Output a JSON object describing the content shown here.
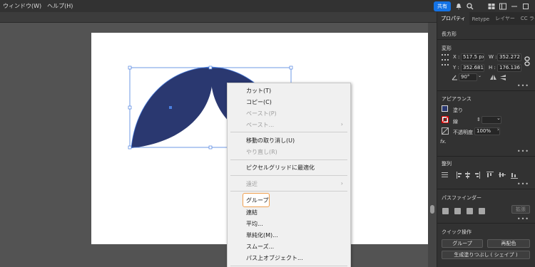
{
  "menubar": {
    "items": [
      "ウィンドウ(W)",
      "ヘルプ(H)"
    ],
    "share_label": "共有"
  },
  "context_menu": {
    "items": [
      {
        "label": "カット(T)",
        "disabled": false
      },
      {
        "label": "コピー(C)",
        "disabled": false
      },
      {
        "label": "ペースト(P)",
        "disabled": true
      },
      {
        "label": "ペースト...",
        "disabled": true,
        "submenu": true
      },
      {
        "label": "移動の取り消し(U)",
        "disabled": false
      },
      {
        "label": "やり直し(R)",
        "disabled": true
      },
      {
        "label": "ピクセルグリッドに最適化",
        "disabled": false
      },
      {
        "label": "遠近",
        "disabled": true,
        "submenu": true
      },
      {
        "label": "グループ",
        "disabled": false,
        "highlighted": true
      },
      {
        "label": "連結",
        "disabled": false
      },
      {
        "label": "平均...",
        "disabled": false
      },
      {
        "label": "単純化(M)...",
        "disabled": false
      },
      {
        "label": "スムーズ...",
        "disabled": false
      },
      {
        "label": "パス上オブジェクト...",
        "disabled": false
      }
    ]
  },
  "panel": {
    "tabs": [
      "プロパティ",
      "Retype",
      "レイヤー",
      "CC ライブ"
    ],
    "object_type": "長方形",
    "transform": {
      "title": "変形",
      "x_label": "X :",
      "x_value": "517.5 px",
      "y_label": "Y :",
      "y_value": "352.681",
      "w_label": "W :",
      "w_value": "352.272",
      "h_label": "H :",
      "h_value": "176.136",
      "angle_value": "90°"
    },
    "appearance": {
      "title": "アピアランス",
      "fill_label": "塗り",
      "stroke_label": "線",
      "opacity_label": "不透明度",
      "opacity_value": "100%",
      "fx_label": "fx."
    },
    "align": {
      "title": "整列"
    },
    "pathfinder": {
      "title": "パスファインダー",
      "expand_label": "拡張"
    },
    "quick_actions": {
      "title": "クイック操作",
      "group_button": "グループ",
      "recolor_button": "再配色",
      "shape_builder_button": "生成塗りつぶし ( シェイプ )"
    }
  },
  "colors": {
    "shape_fill": "#2a3870",
    "selection": "#4a7fe0",
    "accent": "#1473e6",
    "highlight_border": "#f0a050"
  }
}
